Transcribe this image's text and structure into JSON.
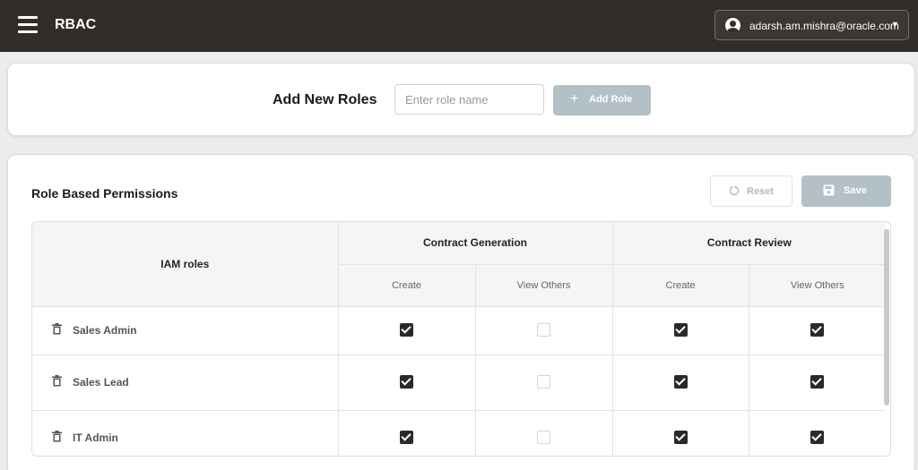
{
  "header": {
    "app_title": "RBAC",
    "user_email": "adarsh.am.mishra@oracle.com",
    "icons": {
      "menu": "hamburger-icon",
      "user": "user-circle-icon",
      "caret": "caret-down-icon"
    },
    "colors": {
      "bar": "#312d2a"
    }
  },
  "add_roles": {
    "title": "Add New Roles",
    "input_value": "",
    "input_placeholder": "Enter role name",
    "button_label": "Add Role",
    "button_icon": "plus-icon"
  },
  "permissions": {
    "title": "Role Based Permissions",
    "reset_label": "Reset",
    "reset_icon": "reset-icon",
    "save_label": "Save",
    "save_icon": "save-icon",
    "table": {
      "roles_header": "IAM roles",
      "groups": [
        {
          "label": "Contract Generation",
          "columns": [
            "Create",
            "View Others"
          ]
        },
        {
          "label": "Contract Review",
          "columns": [
            "Create",
            "View Others"
          ]
        }
      ],
      "rows": [
        {
          "role": "Sales Admin",
          "checks": [
            true,
            false,
            true,
            true
          ]
        },
        {
          "role": "Sales Lead",
          "checks": [
            true,
            false,
            true,
            true
          ]
        },
        {
          "role": "IT Admin",
          "checks": [
            true,
            false,
            true,
            true
          ]
        }
      ]
    }
  },
  "colors": {
    "disabled_button": "#b3c1c6",
    "checkbox_checked": "#2d2926"
  }
}
